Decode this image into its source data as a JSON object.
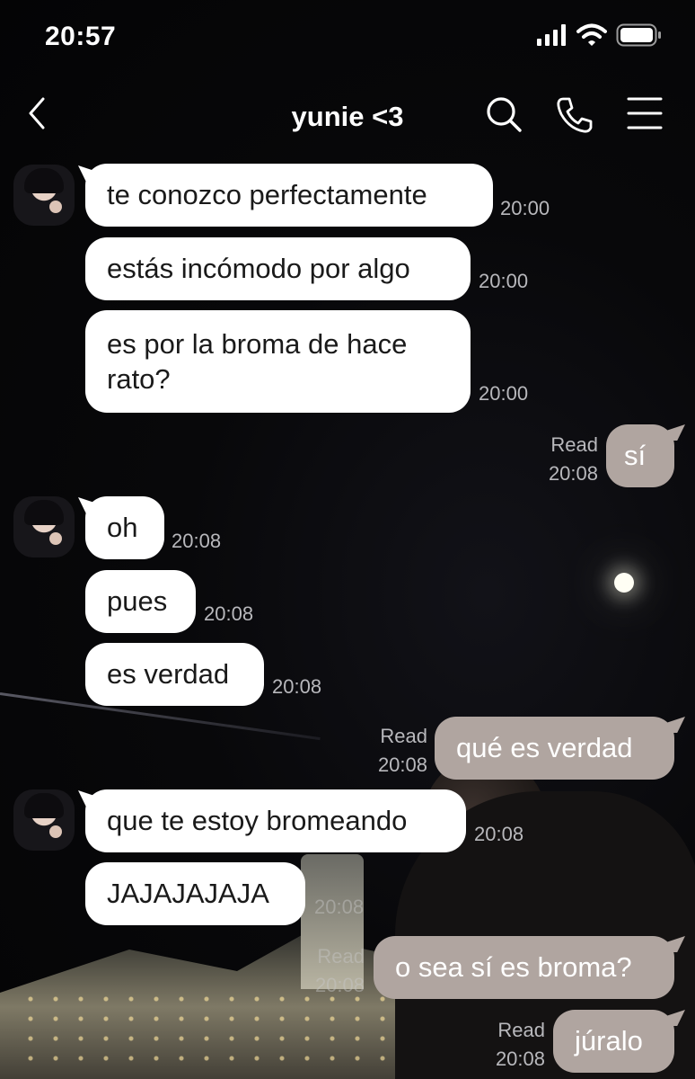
{
  "status_bar": {
    "time": "20:57"
  },
  "nav": {
    "title": "yunie <3"
  },
  "messages": [
    {
      "text": "te conozco perfectamente",
      "time": "20:00"
    },
    {
      "text": "estás incómodo por algo",
      "time": "20:00"
    },
    {
      "text": "es por la broma de hace rato?",
      "time": "20:00"
    },
    {
      "text": "sí",
      "read": "Read",
      "time": "20:08"
    },
    {
      "text": "oh",
      "time": "20:08"
    },
    {
      "text": "pues",
      "time": "20:08"
    },
    {
      "text": "es verdad",
      "time": "20:08"
    },
    {
      "text": "qué es verdad",
      "read": "Read",
      "time": "20:08"
    },
    {
      "text": "que te estoy bromeando",
      "time": "20:08"
    },
    {
      "text": "JAJAJAJAJA",
      "time": "20:08"
    },
    {
      "text": "o sea sí es broma?",
      "read": "Read",
      "time": "20:08"
    },
    {
      "text": "júralo",
      "read": "Read",
      "time": "20:08"
    }
  ],
  "colors": {
    "incoming_bubble": "#ffffff",
    "outgoing_bubble": "#b0a5a0",
    "timestamp": "#b8b8bc"
  },
  "icons": [
    "signal-icon",
    "wifi-icon",
    "battery-icon",
    "back-chevron-icon",
    "search-icon",
    "phone-icon",
    "menu-icon"
  ]
}
